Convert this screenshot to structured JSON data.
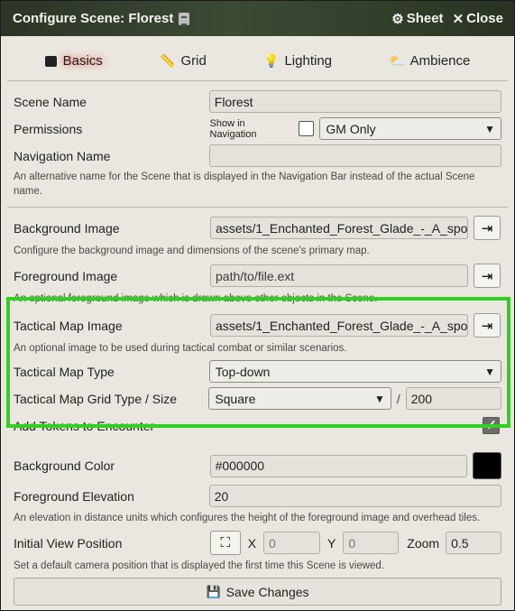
{
  "window": {
    "title": "Configure Scene: Florest",
    "sheet_label": "Sheet",
    "close_label": "Close"
  },
  "tabs": [
    {
      "label": "Basics",
      "icon": "image-icon",
      "active": true
    },
    {
      "label": "Grid",
      "icon": "ruler-icon",
      "active": false
    },
    {
      "label": "Lighting",
      "icon": "lightbulb-icon",
      "active": false
    },
    {
      "label": "Ambience",
      "icon": "cloud-sun-icon",
      "active": false
    }
  ],
  "basics": {
    "scene_name_label": "Scene Name",
    "scene_name_value": "Florest",
    "permissions_label": "Permissions",
    "show_in_navigation_label": "Show in Navigation",
    "show_in_navigation_checked": false,
    "permissions_value": "GM Only",
    "navigation_name_label": "Navigation Name",
    "navigation_name_value": "",
    "navigation_hint": "An alternative name for the Scene that is displayed in the Navigation Bar instead of the actual Scene name."
  },
  "images": {
    "background_label": "Background Image",
    "background_value": "assets/1_Enchanted_Forest_Glade_-_A_spot_",
    "background_hint": "Configure the background image and dimensions of the scene's primary map.",
    "foreground_label": "Foreground Image",
    "foreground_placeholder": "path/to/file.ext",
    "foreground_hint": "An optional foreground image which is drawn above other objects in the Scene."
  },
  "tactical": {
    "map_image_label": "Tactical Map Image",
    "map_image_value": "assets/1_Enchanted_Forest_Glade_-_A_spot_",
    "map_image_hint": "An optional image to be used during tactical combat or similar scenarios.",
    "map_type_label": "Tactical Map Type",
    "map_type_value": "Top-down",
    "grid_label": "Tactical Map Grid Type / Size",
    "grid_type_value": "Square",
    "grid_separator": "/",
    "grid_size_value": "200",
    "add_tokens_label": "Add Tokens to Encounter",
    "add_tokens_checked": true,
    "highlight_color": "#2fd11f"
  },
  "appearance": {
    "bg_color_label": "Background Color",
    "bg_color_value": "#000000",
    "fg_elevation_label": "Foreground Elevation",
    "fg_elevation_value": "20",
    "fg_elevation_hint": "An elevation in distance units which configures the height of the foreground image and overhead tiles."
  },
  "view": {
    "label": "Initial View Position",
    "x_label": "X",
    "x_placeholder": "0",
    "y_label": "Y",
    "y_placeholder": "0",
    "zoom_label": "Zoom",
    "zoom_value": "0.5",
    "hint": "Set a default camera position that is displayed the first time this Scene is viewed."
  },
  "footer": {
    "save_label": "Save Changes"
  }
}
